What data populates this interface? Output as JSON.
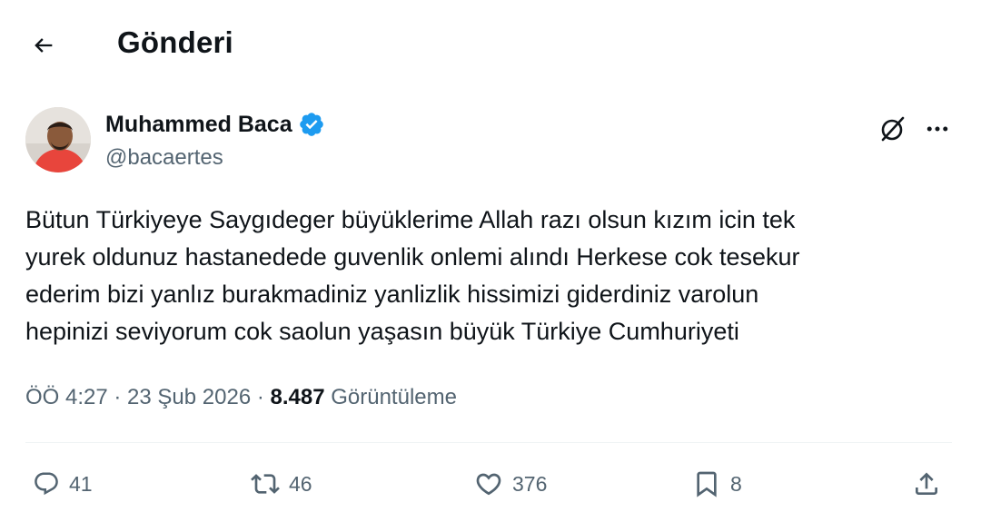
{
  "header": {
    "title": "Gönderi",
    "back_icon": "arrow-left-icon"
  },
  "author": {
    "display_name": "Muhammed Baca",
    "handle": "@bacaertes",
    "verified": true,
    "verified_color": "#1d9bf0"
  },
  "tweet": {
    "lines": [
      "Bütun Türkiyeye Saygıdeger büyüklerime Allah razı olsun kızım icin tek",
      "yurek oldunuz hastanedede guvenlik onlemi alındı Herkese cok tesekur",
      "ederim bizi yanlız burakmadiniz yanlizlik hissimizi giderdiniz varolun",
      "hepinizi seviyorum cok saolun yaşasın büyük Türkiye Cumhuriyeti"
    ]
  },
  "meta": {
    "time": "ÖÖ 4:27",
    "separator": " · ",
    "date": "23 Şub 2026",
    "views_count": "8.487",
    "views_label": " Görüntüleme"
  },
  "actions": {
    "replies": "41",
    "reposts": "46",
    "likes": "376",
    "bookmarks": "8"
  },
  "colors": {
    "text": "#0f1419",
    "secondary": "#536471",
    "accent": "#1d9bf0",
    "divider": "#eff3f4"
  }
}
